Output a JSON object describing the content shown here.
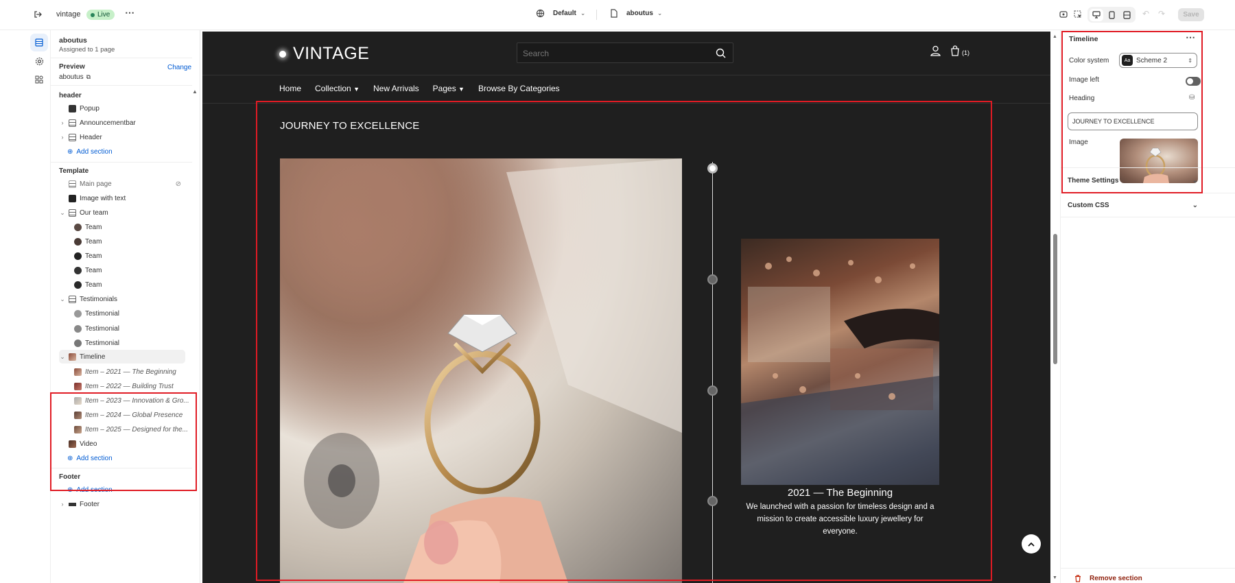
{
  "topbar": {
    "store_name": "vintage",
    "live_label": "Live",
    "theme_selector": "Default",
    "page_selector": "aboutus",
    "save_label": "Save"
  },
  "sidebar": {
    "page_title": "aboutus",
    "page_subtitle": "Assigned to 1 page",
    "preview_label": "Preview",
    "change_label": "Change",
    "preview_value": "aboutus",
    "header_section": "header",
    "header_items": [
      "Popup",
      "Announcementbar",
      "Header"
    ],
    "add_section_label": "Add section",
    "template_section": "Template",
    "template_items": {
      "main_page": "Main page",
      "image_with_text": "Image with text",
      "our_team": "Our team",
      "team": [
        "Team",
        "Team",
        "Team",
        "Team",
        "Team"
      ],
      "testimonials": "Testimonials",
      "testimonial": [
        "Testimonial",
        "Testimonial",
        "Testimonial"
      ],
      "timeline": "Timeline",
      "timeline_items": [
        "Item – 2021 — The Beginning",
        "Item – 2022 — Building Trust",
        "Item – 2023 — Innovation & Gro...",
        "Item – 2024 — Global Presence",
        "Item – 2025 — Designed for the..."
      ],
      "video": "Video"
    },
    "footer_section": "Footer",
    "footer_item": "Footer"
  },
  "site": {
    "logo": "VINTAGE",
    "search_placeholder": "Search",
    "cart_count": "(1)",
    "nav": [
      "Home",
      "Collection",
      "New Arrivals",
      "Pages",
      "Browse By Categories"
    ],
    "section_heading": "JOURNEY TO EXCELLENCE",
    "item_title": "2021 — The Beginning",
    "item_description": "We launched with a passion for timeless design and a mission to create accessible luxury jewellery for everyone."
  },
  "settings": {
    "title": "Timeline",
    "color_system_label": "Color system",
    "color_system_value": "Scheme 2",
    "image_left_label": "Image left",
    "image_left_on": false,
    "heading_label": "Heading",
    "heading_value": "JOURNEY TO EXCELLENCE",
    "image_label": "Image",
    "theme_settings_label": "Theme Settings",
    "custom_css_label": "Custom CSS",
    "remove_section_label": "Remove section"
  },
  "colors": {
    "accent_blue": "#005bd3",
    "highlight_red": "#e01b24",
    "canvas_bg": "#1f1f1f",
    "remove_red": "#8e1f0b"
  }
}
